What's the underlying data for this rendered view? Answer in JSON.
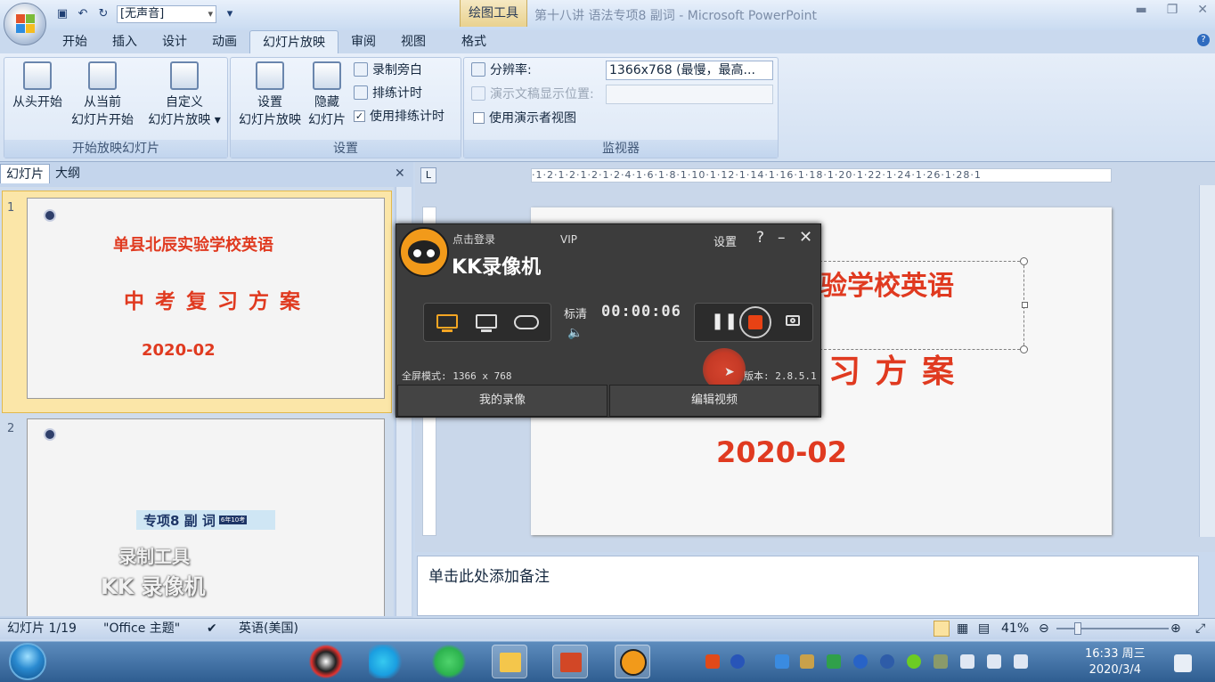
{
  "window": {
    "title": "第十八讲 语法专项8 副词 - Microsoft PowerPoint",
    "context_tab_group": "绘图工具",
    "sound_select": "[无声音]"
  },
  "tabs": [
    "开始",
    "插入",
    "设计",
    "动画",
    "幻灯片放映",
    "审阅",
    "视图",
    "格式"
  ],
  "active_tab": "幻灯片放映",
  "ribbon": {
    "groups": {
      "start": {
        "caption": "开始放映幻灯片",
        "from_beginning": "从头开始",
        "from_current_1": "从当前",
        "from_current_2": "幻灯片开始",
        "custom_1": "自定义",
        "custom_2": "幻灯片放映 ▾"
      },
      "setup": {
        "caption": "设置",
        "setup_show_1": "设置",
        "setup_show_2": "幻灯片放映",
        "hide_1": "隐藏",
        "hide_2": "幻灯片",
        "record_narration": "录制旁白",
        "rehearse_timings": "排练计时",
        "use_timings": "使用排练计时",
        "use_timings_checked": true
      },
      "monitors": {
        "caption": "监视器",
        "resolution_label": "分辨率:",
        "resolution_value": "1366x768 (最慢，最高...",
        "show_on_label": "演示文稿显示位置:",
        "presenter_view": "使用演示者视图"
      }
    }
  },
  "left_panel": {
    "tab_slides": "幻灯片",
    "tab_outline": "大纲",
    "slides": [
      {
        "number": "1",
        "school": "单县北辰实验学校英语",
        "plan": "中 考 复 习 方 案",
        "date": "2020-02"
      },
      {
        "number": "2",
        "banner": "专项8  副  词",
        "banner_tag": "6年10考",
        "watermark_1": "录制工具",
        "watermark_2": "KK 录像机"
      }
    ]
  },
  "slide": {
    "title_visible": "验学校英语",
    "subtitle_visible": "习 方 案",
    "date": "2020-02"
  },
  "ruler": {
    "text": "·1·2·1·2·1·2·1·2·4·1·6·1·8·1·10·1·12·1·14·1·16·1·18·1·20·1·22·1·24·1·26·1·28·1"
  },
  "notes_placeholder": "单击此处添加备注",
  "status": {
    "slide_count": "幻灯片 1/19",
    "theme": "\"Office 主题\"",
    "language": "英语(美国)",
    "zoom": "41%"
  },
  "taskbar": {
    "time": "16:33 周三",
    "date": "2020/3/4"
  },
  "kk_recorder": {
    "login": "点击登录",
    "vip": "VIP",
    "settings": "设置",
    "help": "?",
    "title": "KK录像机",
    "quality": "标清",
    "elapsed": "00:00:06",
    "fullscreen_mode": "全屏模式: 1366 x 768",
    "version": "版本: 2.8.5.1",
    "my_recordings": "我的录像",
    "edit_video": "编辑视频"
  },
  "colors": {
    "slide_red": "#e03a20",
    "kk_orange": "#f29a1a",
    "stop_red": "#e84214"
  }
}
